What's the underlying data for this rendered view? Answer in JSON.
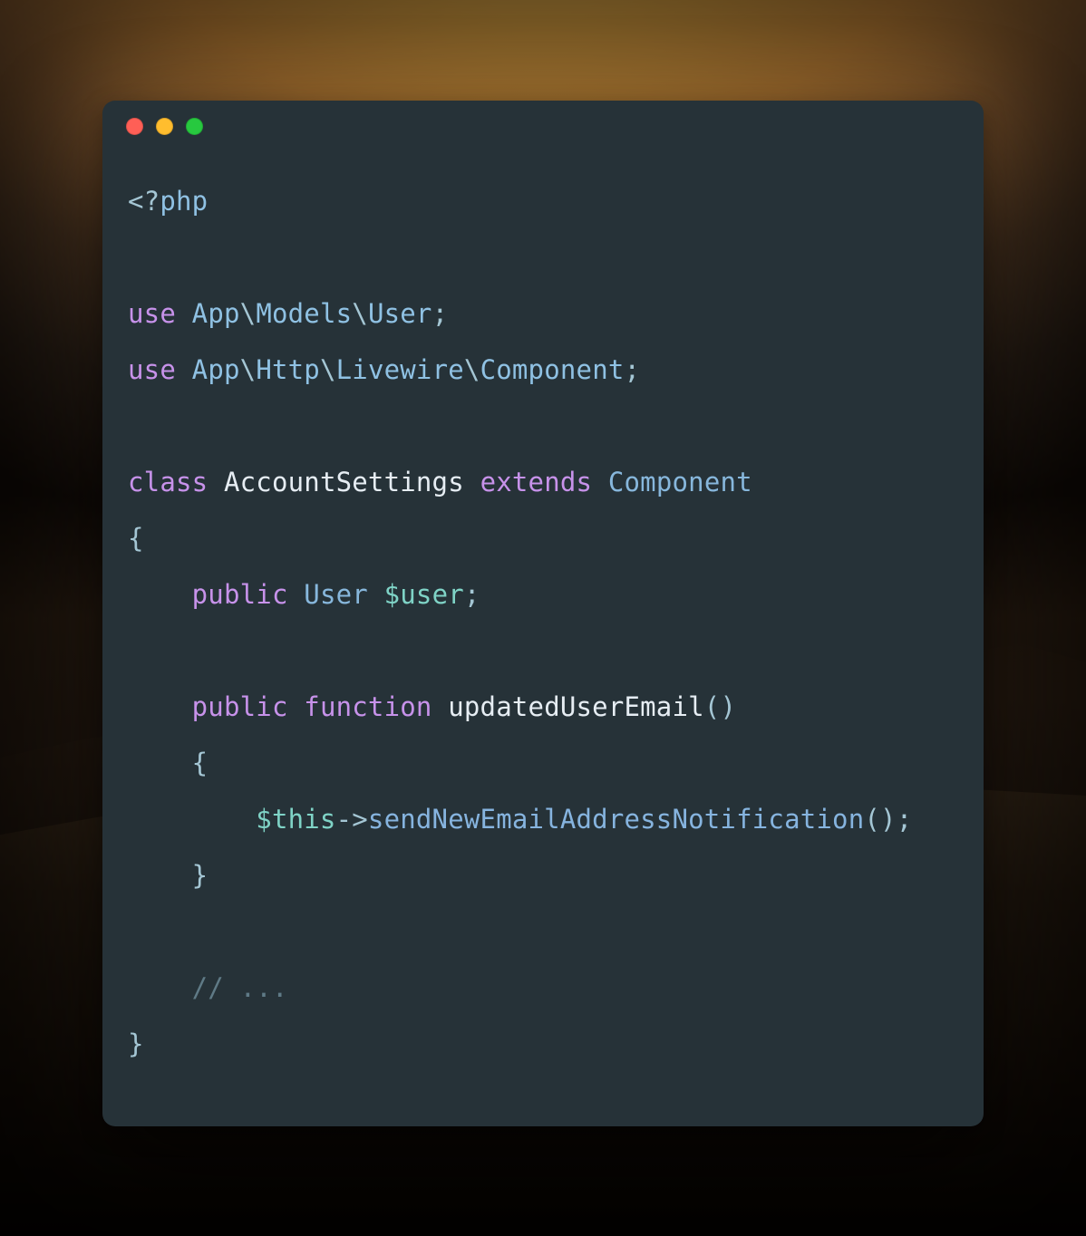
{
  "colors": {
    "window_bg": "#263238",
    "text": "#e6edf3",
    "keyword": "#c792ea",
    "namespace": "#8fc1e3",
    "type": "#87b7dc",
    "func": "#86b4df",
    "var": "#7fd3c6",
    "comment": "#5f7a86",
    "punct": "#a4c6d4",
    "traffic_red": "#ff5f56",
    "traffic_amber": "#ffbd2e",
    "traffic_green": "#27c93f"
  },
  "code": {
    "l1": {
      "t1": "<?",
      "t2": "php"
    },
    "l2": {
      "t1": "use",
      "t2": " ",
      "t3": "App",
      "t4": "\\",
      "t5": "Models",
      "t6": "\\",
      "t7": "User",
      "t8": ";"
    },
    "l3": {
      "t1": "use",
      "t2": " ",
      "t3": "App",
      "t4": "\\",
      "t5": "Http",
      "t6": "\\",
      "t7": "Livewire",
      "t8": "\\",
      "t9": "Component",
      "t10": ";"
    },
    "l4": {
      "t1": "class",
      "t2": " ",
      "t3": "AccountSettings",
      "t4": " ",
      "t5": "extends",
      "t6": " ",
      "t7": "Component"
    },
    "l5": {
      "t1": "{"
    },
    "l6": {
      "t1": "    ",
      "t2": "public",
      "t3": " ",
      "t4": "User",
      "t5": " ",
      "t6": "$user",
      "t7": ";"
    },
    "l7": {
      "t1": "    ",
      "t2": "public",
      "t3": " ",
      "t4": "function",
      "t5": " ",
      "t6": "updatedUserEmail",
      "t7": "()"
    },
    "l8": {
      "t1": "    ",
      "t2": "{"
    },
    "l9": {
      "t1": "        ",
      "t2": "$this",
      "t3": "->",
      "t4": "sendNewEmailAddressNotification",
      "t5": "();"
    },
    "l10": {
      "t1": "    ",
      "t2": "}"
    },
    "l11": {
      "t1": "    ",
      "t2": "// ..."
    },
    "l12": {
      "t1": "}"
    }
  }
}
